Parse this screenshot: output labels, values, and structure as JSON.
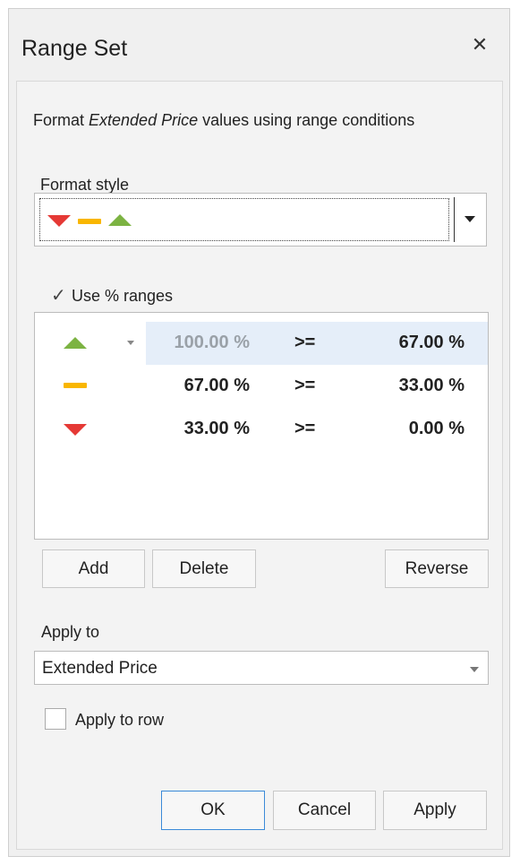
{
  "dialog": {
    "title": "Range Set",
    "close_glyph": "✕"
  },
  "description": {
    "prefix": "Format ",
    "field": "Extended Price",
    "suffix": " values using range conditions"
  },
  "format_style": {
    "label": "Format style",
    "icons": [
      "red-down-triangle-icon",
      "yellow-dash-icon",
      "green-up-triangle-icon"
    ]
  },
  "use_percent": {
    "label": "Use % ranges",
    "checked": true
  },
  "ranges": [
    {
      "icon": "green-up-triangle-icon",
      "from": "100.00 %",
      "op": ">=",
      "to": "67.00 %"
    },
    {
      "icon": "yellow-dash-icon",
      "from": "67.00 %",
      "op": ">=",
      "to": "33.00 %"
    },
    {
      "icon": "red-down-triangle-icon",
      "from": "33.00 %",
      "op": ">=",
      "to": "0.00 %"
    }
  ],
  "range_buttons": {
    "add": "Add",
    "delete": "Delete",
    "reverse": "Reverse"
  },
  "apply_to": {
    "label": "Apply to",
    "value": "Extended Price"
  },
  "apply_to_row": {
    "label": "Apply to row",
    "checked": false
  },
  "footer": {
    "ok": "OK",
    "cancel": "Cancel",
    "apply": "Apply"
  },
  "colors": {
    "up": "#7cb342",
    "mid": "#f9b600",
    "down": "#e53935",
    "selected_row": "#e5eef9",
    "focus_border": "#3b8ad8"
  }
}
